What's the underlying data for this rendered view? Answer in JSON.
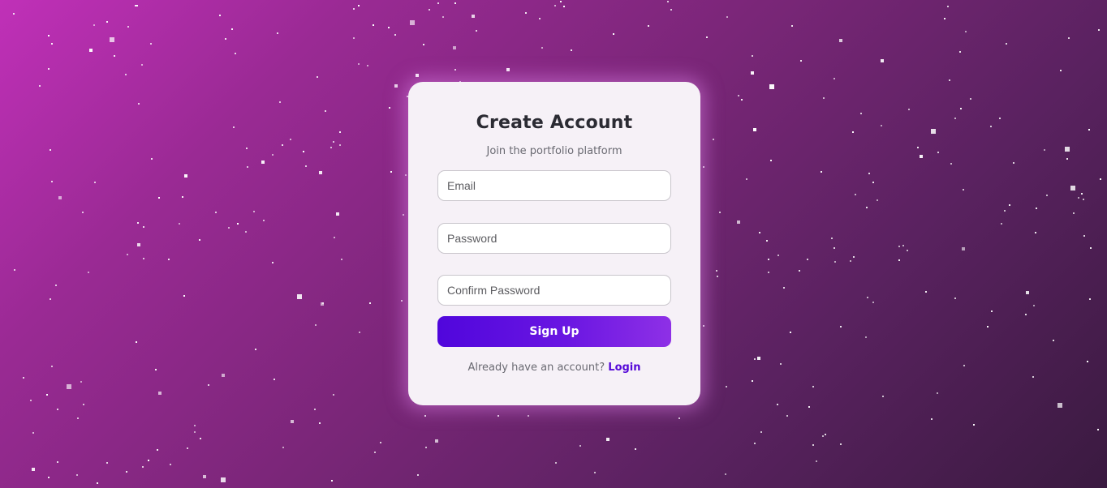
{
  "form": {
    "title": "Create Account",
    "subtitle": "Join the portfolio platform",
    "email_placeholder": "Email",
    "password_placeholder": "Password",
    "confirm_password_placeholder": "Confirm Password",
    "signup_label": "Sign Up",
    "footer_text": "Already have an account?",
    "login_label": "Login"
  },
  "colors": {
    "accent": "#5508d8",
    "button_gradient_start": "#5006dc",
    "button_gradient_end": "#8e30e6",
    "background_start": "#c030b8",
    "background_end": "#3a1a40",
    "card_background": "#f6f1f7"
  }
}
